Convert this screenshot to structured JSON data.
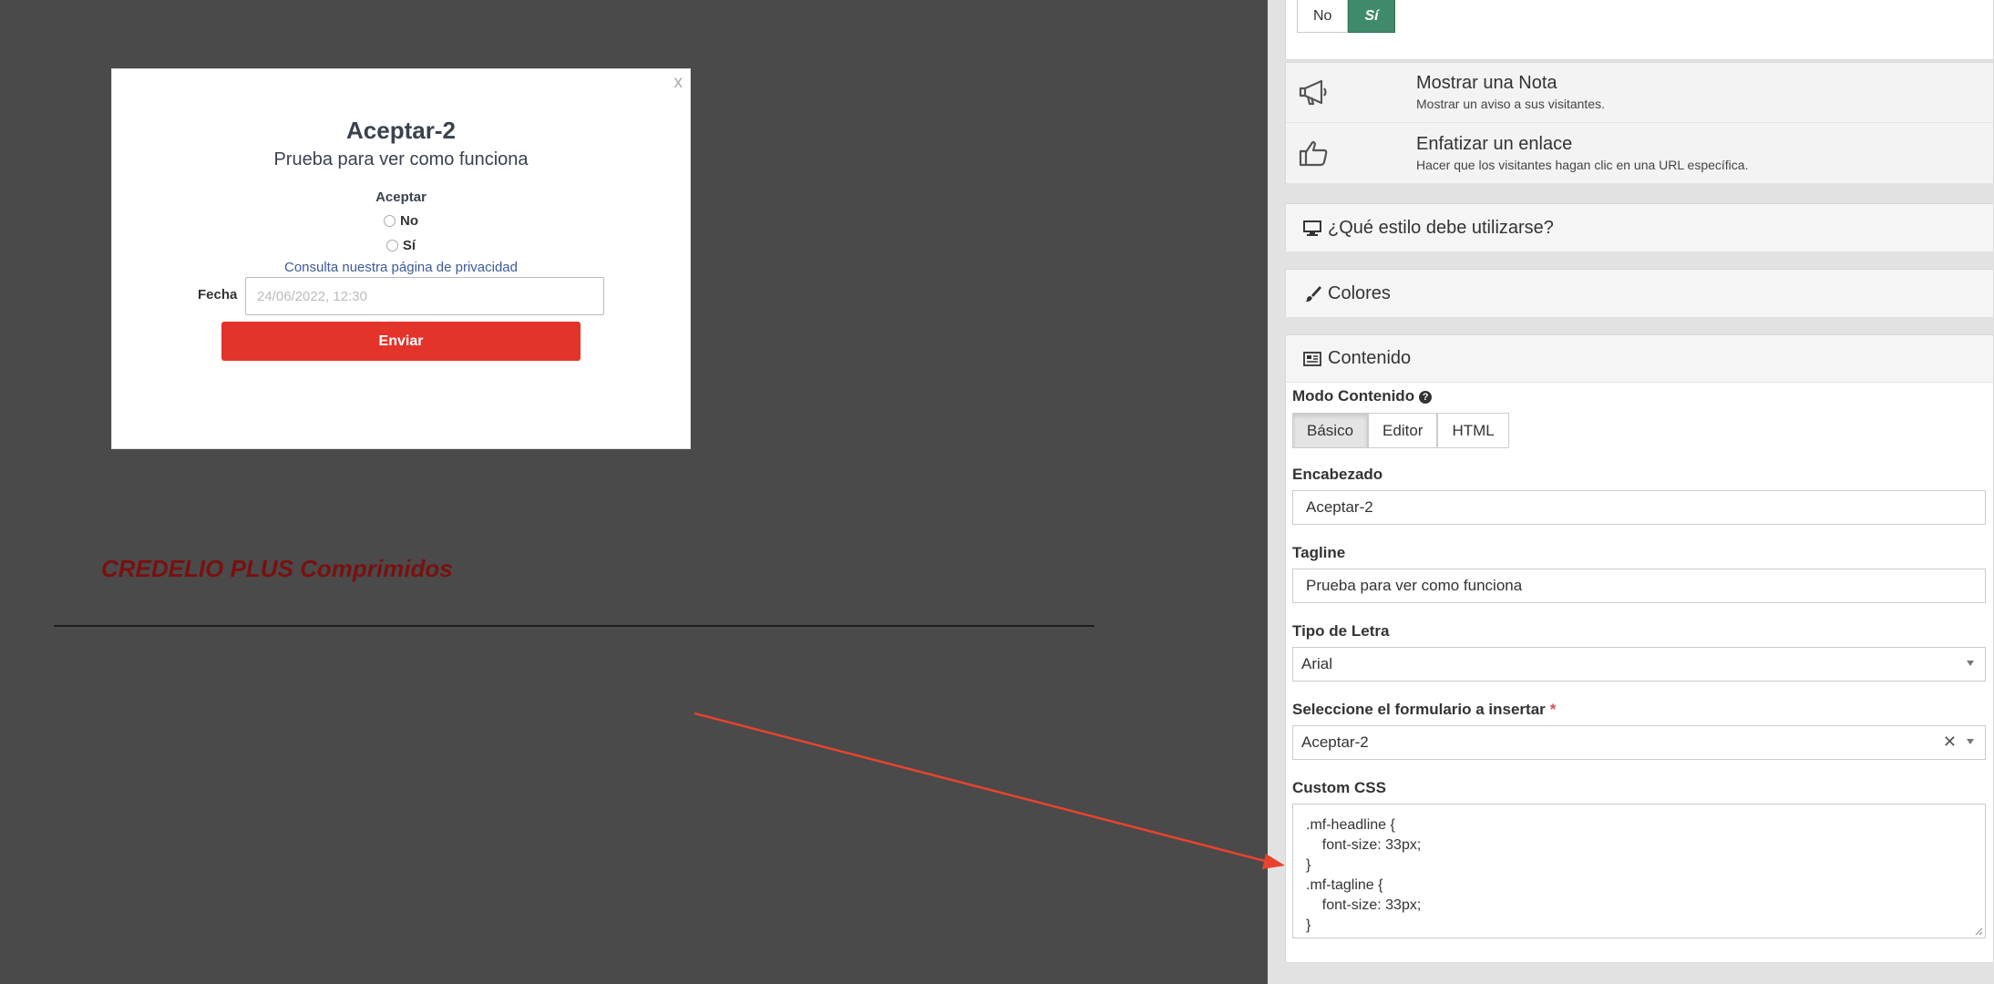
{
  "popup": {
    "close": "x",
    "headline": "Aceptar-2",
    "tagline": "Prueba para ver como funciona",
    "field_label": "Aceptar",
    "options": [
      "No",
      "Sí"
    ],
    "privacy_link": "Consulta nuestra página de privacidad",
    "date_label": "Fecha",
    "date_value": "24/06/2022, 12:30",
    "submit_label": "Enviar"
  },
  "page": {
    "product_title": "CREDELIO PLUS Comprimidos"
  },
  "panel": {
    "toggle": {
      "no": "No",
      "yes": "Sí",
      "selected": "Sí"
    },
    "options": [
      {
        "icon": "megaphone-icon",
        "title": "Mostrar una Nota",
        "desc": "Mostrar un aviso a sus visitantes."
      },
      {
        "icon": "hand-pointer-icon",
        "title": "Enfatizar un enlace",
        "desc": "Hacer que los visitantes hagan clic en una URL específica."
      }
    ],
    "style_section": "¿Qué estilo debe utilizarse?",
    "colors_section": "Colores",
    "content_section": "Contenido",
    "content": {
      "mode_label": "Modo Contenido",
      "modes": [
        "Básico",
        "Editor",
        "HTML"
      ],
      "mode_selected": "Básico",
      "headline_label": "Encabezado",
      "headline_value": "Aceptar-2",
      "tagline_label": "Tagline",
      "tagline_value": "Prueba para ver como funciona",
      "font_label": "Tipo de Letra",
      "font_value": "Arial",
      "form_label": "Seleccione el formulario a insertar",
      "required_mark": "*",
      "form_value": "Aceptar-2",
      "clear_mark": "✕",
      "css_label": "Custom CSS",
      "css_lines": [
        ".mf-headline {",
        "    font-size: 33px;",
        "}",
        ".mf-tagline {",
        "    font-size: 33px;",
        "}"
      ]
    }
  },
  "colors": {
    "toggle_active": "#3f8a6a",
    "submit": "#e3342a",
    "product_title": "#7a1010",
    "arrow": "#e8432f",
    "background": "#4a4a4a"
  }
}
